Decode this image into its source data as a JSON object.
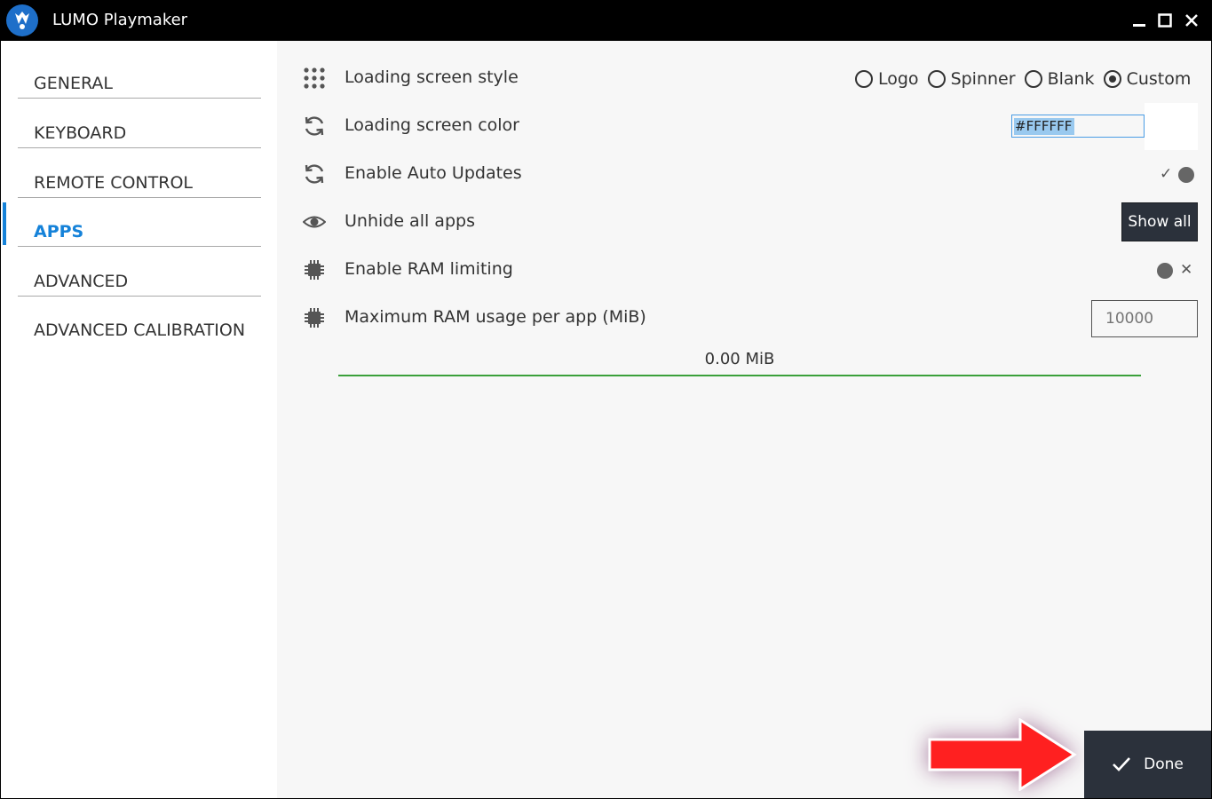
{
  "window": {
    "title": "LUMO Playmaker"
  },
  "sidebar": {
    "items": [
      {
        "label": "GENERAL"
      },
      {
        "label": "KEYBOARD"
      },
      {
        "label": "REMOTE CONTROL"
      },
      {
        "label": "APPS",
        "active": true
      },
      {
        "label": "ADVANCED"
      },
      {
        "label": "ADVANCED CALIBRATION"
      }
    ]
  },
  "settings": {
    "loading_style": {
      "label": "Loading screen style",
      "options": [
        "Logo",
        "Spinner",
        "Blank",
        "Custom"
      ],
      "selected": "Custom"
    },
    "loading_color": {
      "label": "Loading screen color",
      "value": "#FFFFFF"
    },
    "auto_updates": {
      "label": "Enable Auto Updates",
      "enabled": true
    },
    "unhide_apps": {
      "label": "Unhide all apps",
      "button_label": "Show all"
    },
    "ram_limiting": {
      "label": "Enable RAM limiting",
      "enabled": false
    },
    "max_ram": {
      "label": "Maximum RAM usage per app (MiB)",
      "placeholder": "10000"
    },
    "ram_usage": {
      "value": "0.00 MiB"
    }
  },
  "footer": {
    "done_label": "Done"
  },
  "colors": {
    "accent": "#1582d9",
    "dark_button": "#2b313b",
    "progress": "#3aa03a",
    "annotation_arrow": "#ff2020"
  }
}
